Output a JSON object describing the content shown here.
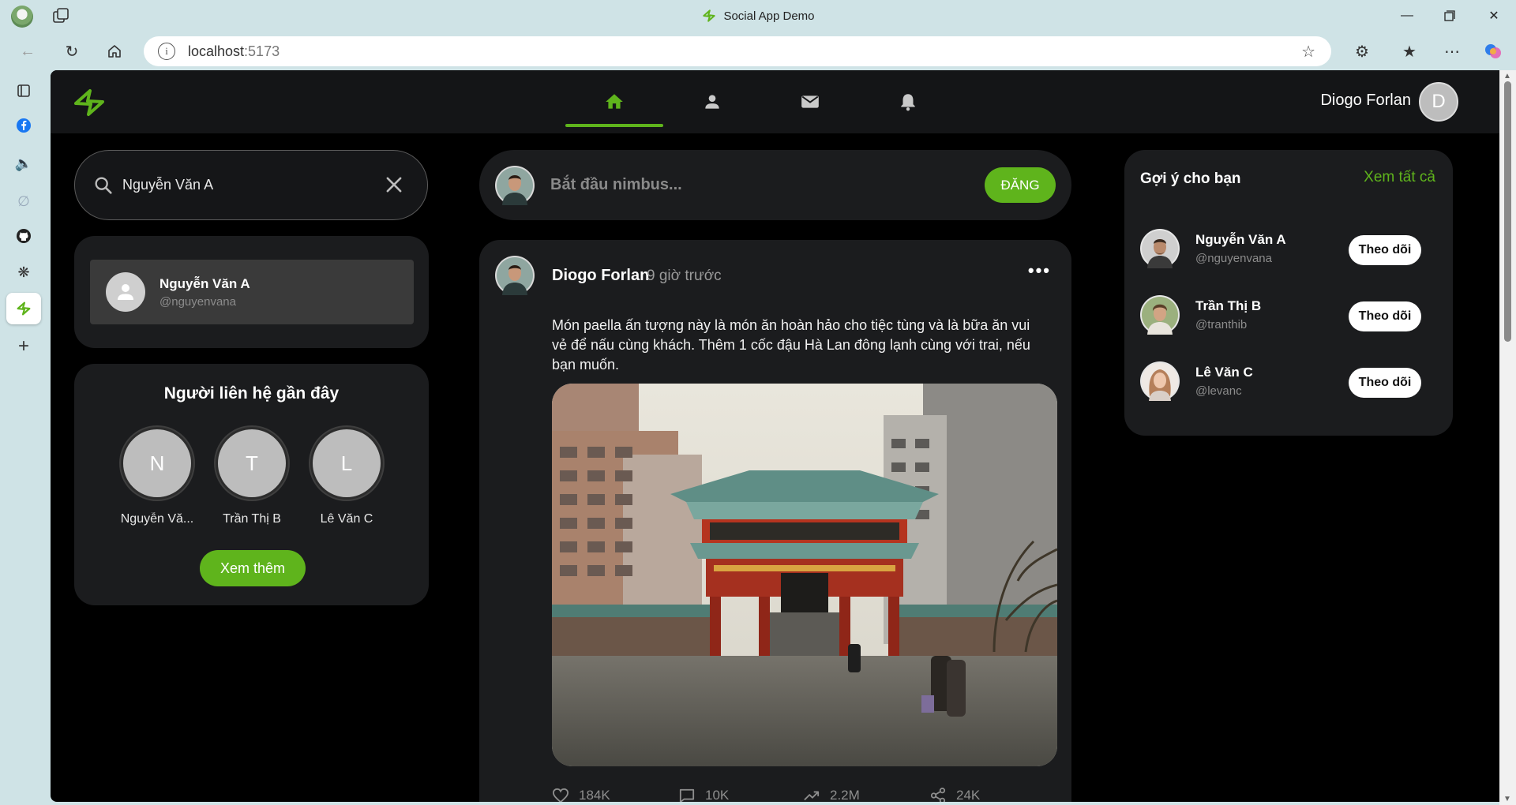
{
  "browser": {
    "window_title": "Social App Demo",
    "url_host": "localhost",
    "url_port": ":5173"
  },
  "header": {
    "user_name": "Diogo Forlan",
    "user_initial": "D",
    "active_tab": "home",
    "tabs": [
      "home",
      "profile",
      "messages",
      "notifications"
    ]
  },
  "search": {
    "value": "Nguyễn Văn A",
    "results": [
      {
        "name": "Nguyễn Văn A",
        "handle": "@nguyenvana"
      }
    ]
  },
  "contacts": {
    "title": "Người liên hệ gần đây",
    "items": [
      {
        "initial": "N",
        "name": "Nguyễn Vă..."
      },
      {
        "initial": "T",
        "name": "Trần Thị B"
      },
      {
        "initial": "L",
        "name": "Lê Văn C"
      }
    ],
    "see_more_label": "Xem thêm"
  },
  "composer": {
    "placeholder": "Bắt đầu nimbus...",
    "post_label": "ĐĂNG"
  },
  "post": {
    "author": "Diogo Forlan",
    "time": "9 giờ trước",
    "text": "Món paella ấn tượng này là món ăn hoàn hảo cho tiệc tùng và là bữa ăn vui vẻ để nấu cùng khách. Thêm 1 cốc đậu Hà Lan đông lạnh cùng với trai, nếu bạn muốn.",
    "more_label": "•••",
    "likes": "184K",
    "comments": "10K",
    "views": "2.2M",
    "shares": "24K"
  },
  "suggestions": {
    "title": "Gợi ý cho bạn",
    "see_all_label": "Xem tất cả",
    "follow_label": "Theo dõi",
    "items": [
      {
        "name": "Nguyễn Văn A",
        "handle": "@nguyenvana"
      },
      {
        "name": "Trần Thị B",
        "handle": "@tranthib"
      },
      {
        "name": "Lê Văn C",
        "handle": "@levanc"
      }
    ]
  },
  "colors": {
    "accent": "#5fb41c",
    "app_bg": "#000000",
    "card_bg": "#1b1c1e",
    "header_bg": "#141517",
    "chrome_bg": "#cfe3e6"
  }
}
